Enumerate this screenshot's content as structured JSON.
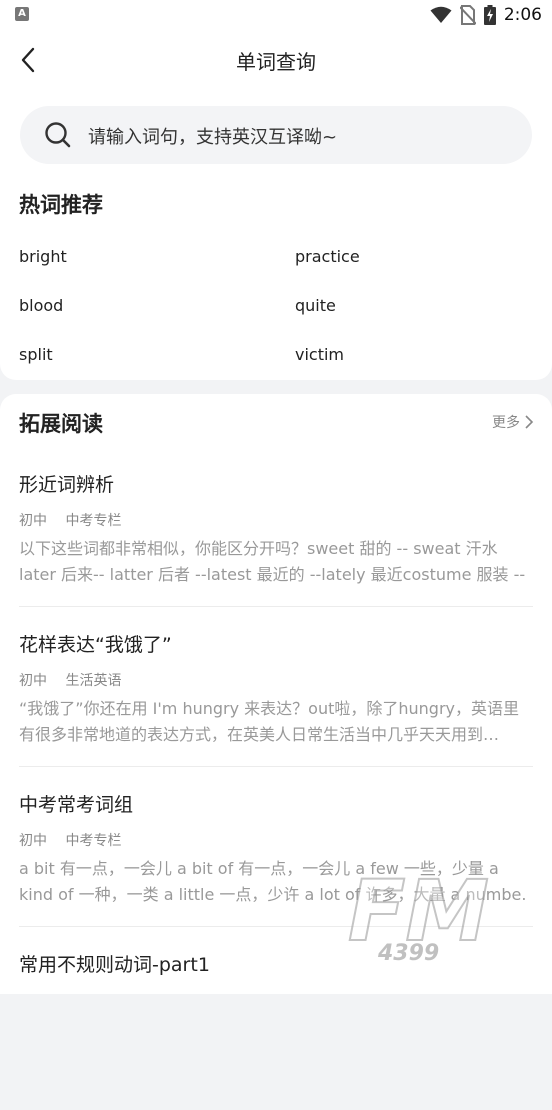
{
  "status_bar": {
    "app_badge": "A",
    "time": "2:06"
  },
  "header": {
    "title": "单词查询"
  },
  "search": {
    "placeholder": "请输入词句，支持英汉互译呦~"
  },
  "hot_words": {
    "title": "热词推荐",
    "items": [
      "bright",
      "practice",
      "blood",
      "quite",
      "split",
      "victim"
    ]
  },
  "extended_reading": {
    "title": "拓展阅读",
    "more_label": "更多",
    "articles": [
      {
        "title": "形近词辨析",
        "tags": [
          "初中",
          "中考专栏"
        ],
        "summary": "以下这些词都非常相似，你能区分开吗？sweet 甜的 -- sweat 汗水 later 后来-- latter 后者 --latest 最近的 --lately 最近costume 服装 --"
      },
      {
        "title": "花样表达“我饿了”",
        "tags": [
          "初中",
          "生活英语"
        ],
        "summary": "“我饿了”你还在用 I'm hungry 来表达？out啦，除了hungry，英语里有很多非常地道的表达方式，在英美人日常生活当中几乎天天用到…"
      },
      {
        "title": "中考常考词组",
        "tags": [
          "初中",
          "中考专栏"
        ],
        "summary": "a bit 有一点，一会儿 a bit of 有一点，一会儿 a few 一些，少量 a kind of 一种，一类 a little 一点，少许 a lot of 许多，大量 a numbe."
      },
      {
        "title": "常用不规则动词-part1",
        "tags": [],
        "summary": ""
      }
    ]
  },
  "watermark": {
    "text": "FM",
    "sub": "4399"
  },
  "colors": {
    "background": "#f2f3f5",
    "card": "#ffffff",
    "search_bg": "#f3f4f6",
    "muted": "#999999"
  }
}
